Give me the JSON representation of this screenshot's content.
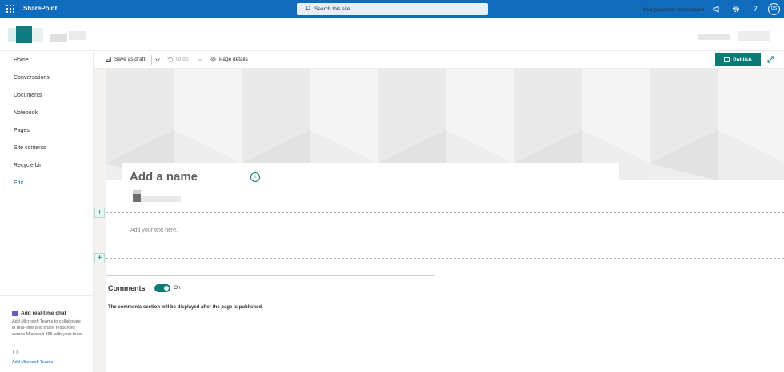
{
  "suite_bar": {
    "app_name": "SharePoint",
    "search_placeholder": "Search this site",
    "avatar_initials": "DS",
    "icons": [
      "waffle-icon",
      "megaphone-icon",
      "gear-icon",
      "help-icon"
    ]
  },
  "left_nav": {
    "items": [
      {
        "label": "Home"
      },
      {
        "label": "Conversations"
      },
      {
        "label": "Documents"
      },
      {
        "label": "Notebook"
      },
      {
        "label": "Pages"
      },
      {
        "label": "Site contents"
      },
      {
        "label": "Recycle bin"
      }
    ],
    "edit_label": "Edit",
    "chat": {
      "title": "Add real-time chat",
      "description": "Add Microsoft Teams to collaborate in real-time and share resources across Microsoft 365 with your team.",
      "link": "Add Microsoft Teams"
    }
  },
  "command_bar": {
    "save_draft": "Save as draft",
    "undo": "Undo",
    "page_details": "Page details",
    "saved_status": "Your page has been saved",
    "publish": "Publish"
  },
  "page": {
    "title_placeholder": "Add a name",
    "text_placeholder": "Add your text here.",
    "comments_title": "Comments",
    "comments_toggle": "On",
    "comments_note": "The comments section will be displayed after the page is published."
  },
  "colors": {
    "suite_bar": "#0f6cbd",
    "accent": "#0b7a75"
  }
}
